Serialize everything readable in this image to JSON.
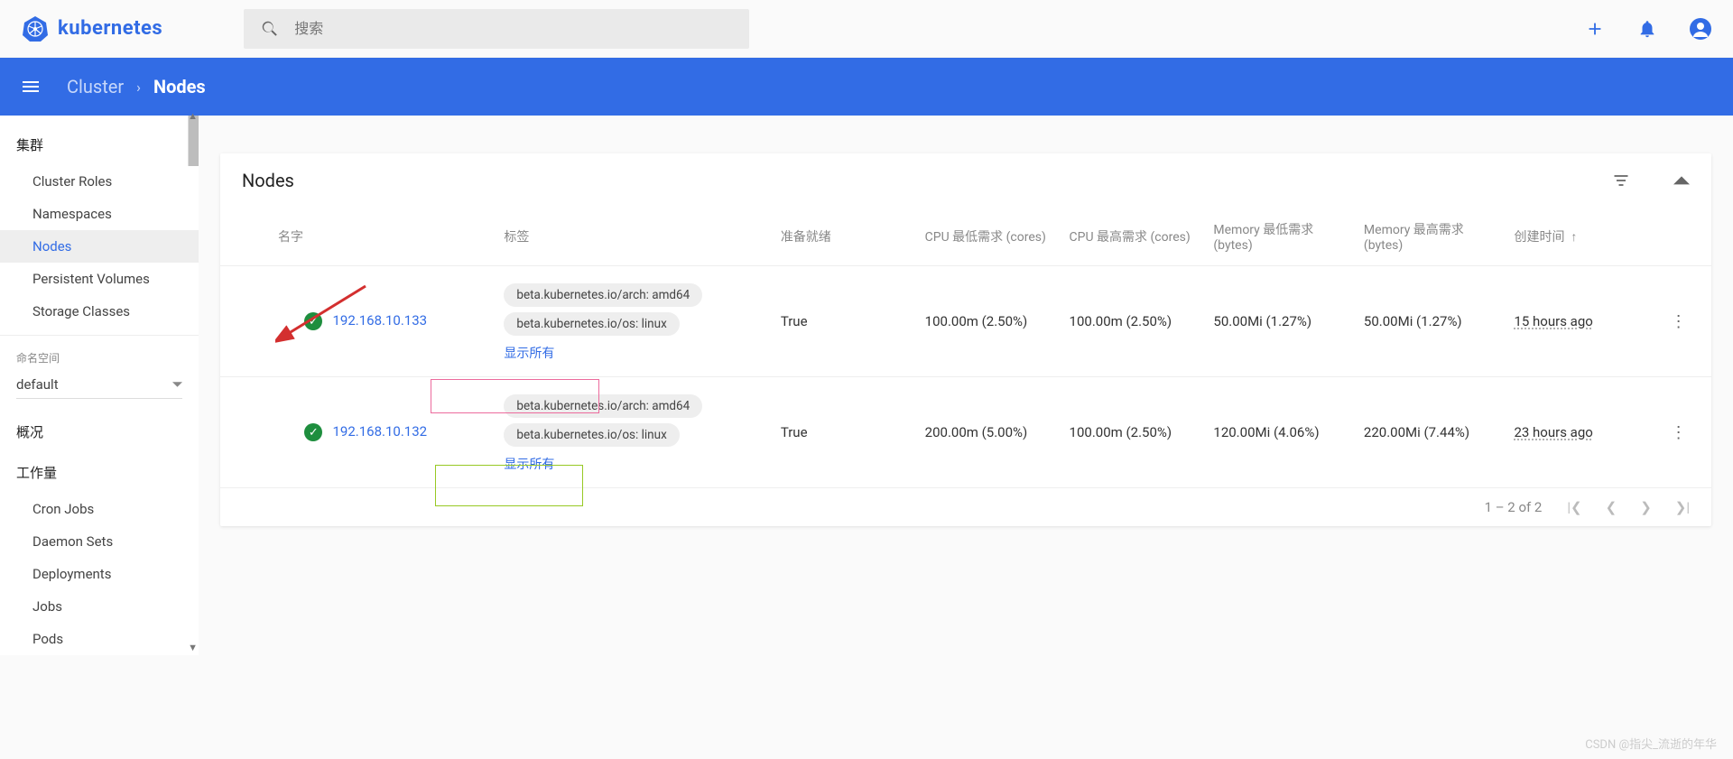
{
  "header": {
    "brand": "kubernetes",
    "search_placeholder": "搜索",
    "breadcrumb_root": "Cluster",
    "breadcrumb_leaf": "Nodes"
  },
  "sidebar": {
    "cluster_label": "集群",
    "cluster_items": [
      "Cluster Roles",
      "Namespaces",
      "Nodes",
      "Persistent Volumes",
      "Storage Classes"
    ],
    "selected_cluster_idx": 2,
    "namespace_label": "命名空间",
    "namespace_selected": "default",
    "overview_label": "概况",
    "workload_label": "工作量",
    "workload_items": [
      "Cron Jobs",
      "Daemon Sets",
      "Deployments",
      "Jobs",
      "Pods"
    ]
  },
  "table": {
    "title": "Nodes",
    "columns": {
      "name": "名字",
      "labels": "标签",
      "ready": "准备就绪",
      "cpu_req": "CPU 最低需求 (cores)",
      "cpu_lim": "CPU 最高需求 (cores)",
      "mem_req": "Memory 最低需求 (bytes)",
      "mem_lim": "Memory 最高需求 (bytes)",
      "created": "创建时间"
    },
    "show_all": "显示所有",
    "rows": [
      {
        "name": "192.168.10.133",
        "labels": [
          "beta.kubernetes.io/arch: amd64",
          "beta.kubernetes.io/os: linux"
        ],
        "ready": "True",
        "cpu_req": "100.00m (2.50%)",
        "cpu_lim": "100.00m (2.50%)",
        "mem_req": "50.00Mi (1.27%)",
        "mem_lim": "50.00Mi (1.27%)",
        "created": "15 hours ago"
      },
      {
        "name": "192.168.10.132",
        "labels": [
          "beta.kubernetes.io/arch: amd64",
          "beta.kubernetes.io/os: linux"
        ],
        "ready": "True",
        "cpu_req": "200.00m (5.00%)",
        "cpu_lim": "100.00m (2.50%)",
        "mem_req": "120.00Mi (4.06%)",
        "mem_lim": "220.00Mi (7.44%)",
        "created": "23 hours ago"
      }
    ],
    "pager_text": "1 – 2 of 2"
  },
  "watermark": "CSDN @指尖_流逝的年华"
}
